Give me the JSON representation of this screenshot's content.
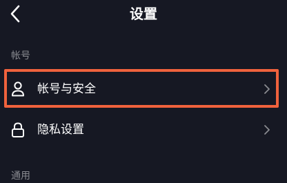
{
  "header": {
    "title": "设置",
    "back_icon": "chevron-left-icon"
  },
  "sections": {
    "account": {
      "label": "帐号"
    },
    "general": {
      "label": "通用"
    }
  },
  "rows": {
    "account_security": {
      "label": "帐号与安全",
      "icon": "user-icon",
      "highlighted": true
    },
    "privacy_settings": {
      "label": "隐私设置",
      "icon": "lock-icon"
    }
  },
  "colors": {
    "background": "#161823",
    "text_primary": "#ffffff",
    "text_secondary": "#8a8b91",
    "highlight": "#f0623d"
  }
}
